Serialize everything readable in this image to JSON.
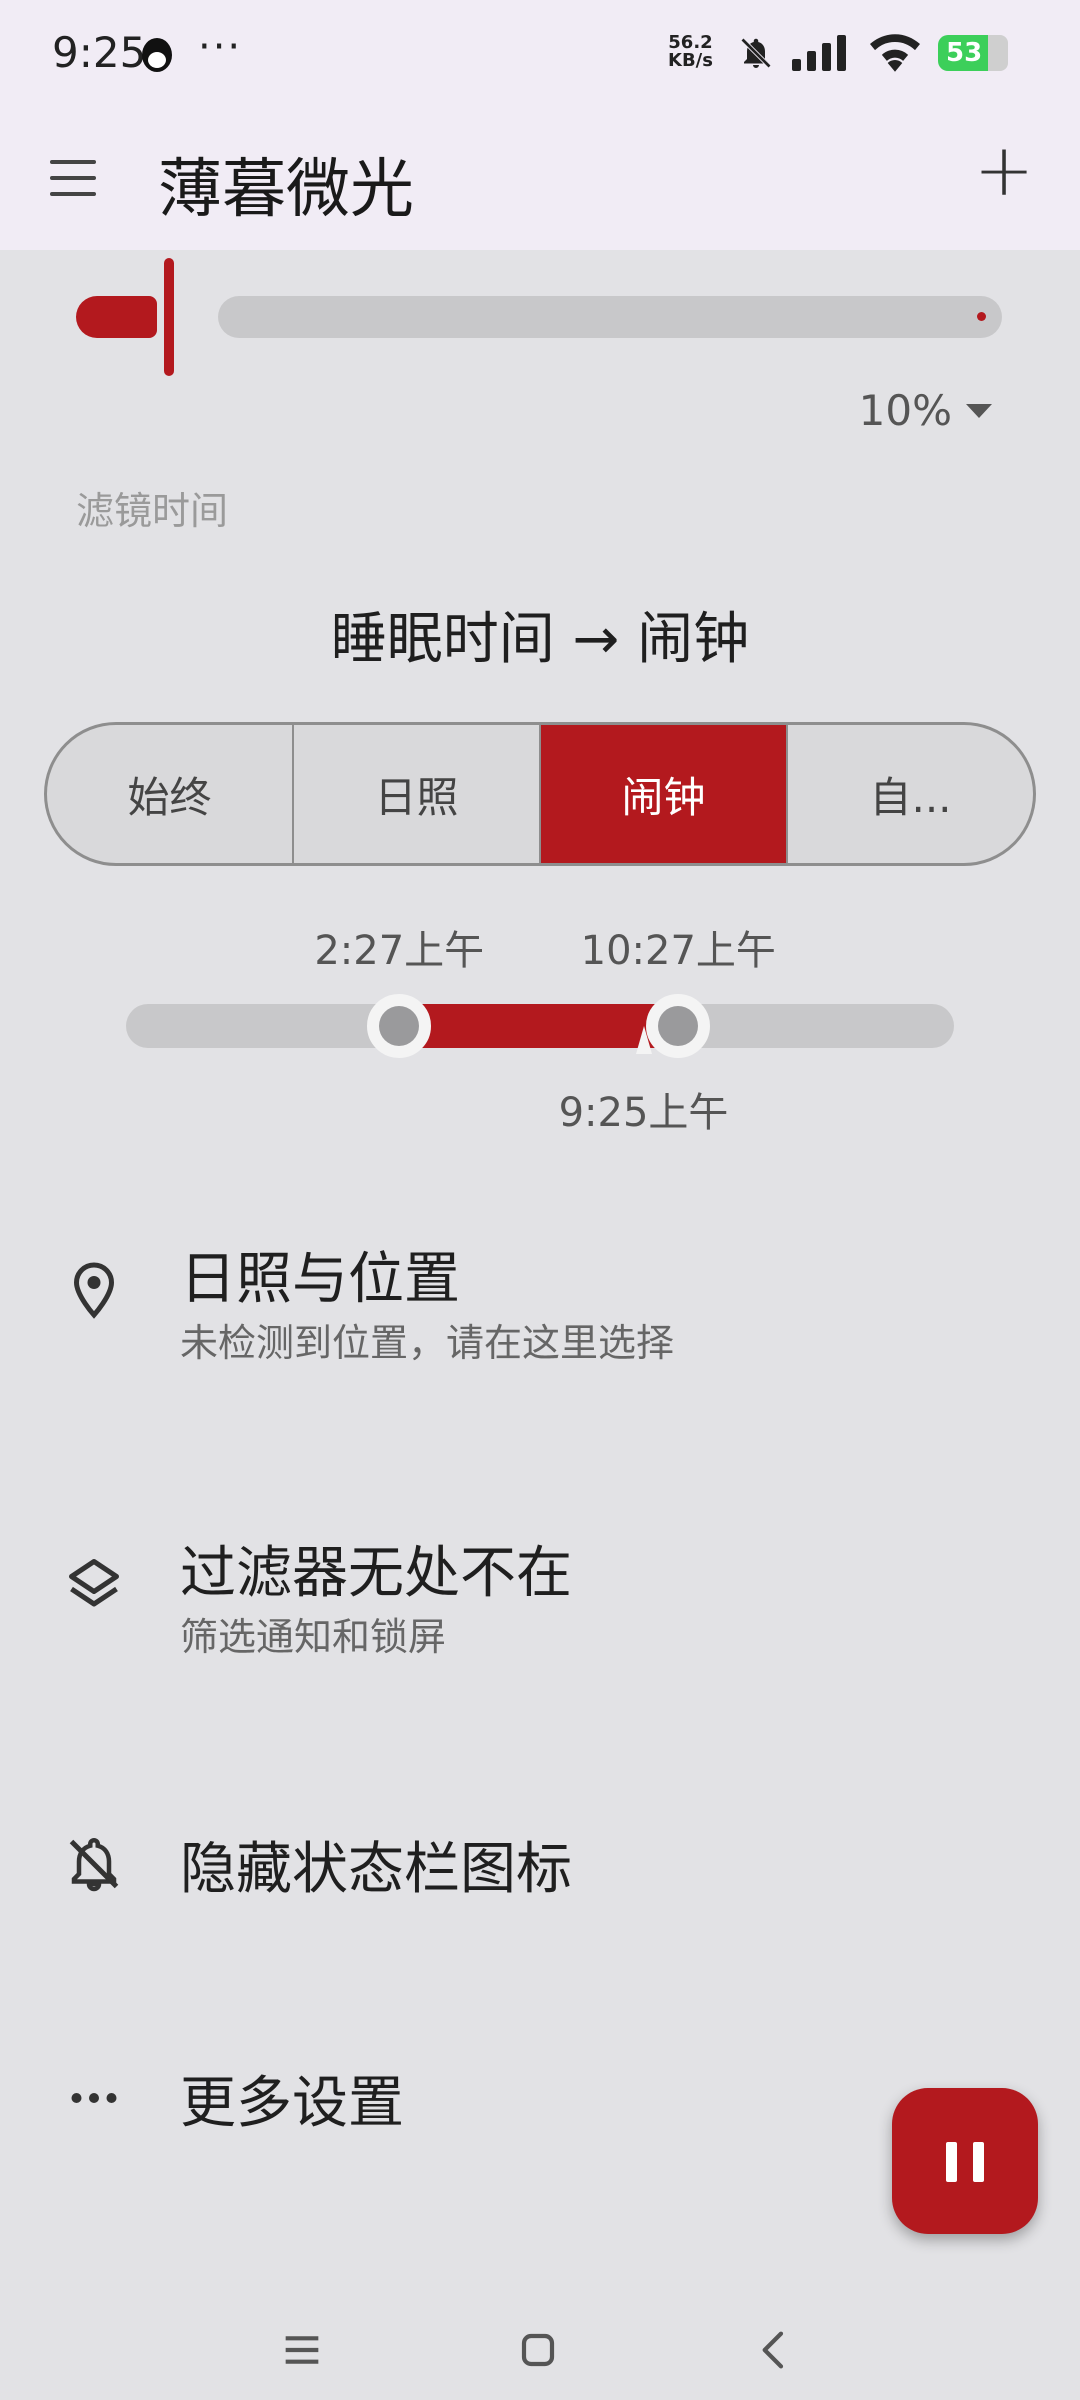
{
  "status_bar": {
    "time": "9:25",
    "more": "···",
    "net_speed_value": "56.2",
    "net_speed_unit": "KB/s",
    "battery": "53",
    "icons": [
      "qq-icon",
      "bell-off-icon",
      "signal-icon",
      "wifi-icon",
      "battery-charging-icon"
    ]
  },
  "app_bar": {
    "title": "薄暮微光",
    "menu_icon": "hamburger-menu-icon",
    "add_icon": "plus-icon"
  },
  "intensity": {
    "value_percent": 10,
    "label": "10%"
  },
  "schedule": {
    "section_label": "滤镜时间",
    "title": "睡眠时间 → 闹钟",
    "modes": [
      {
        "label": "始终",
        "active": false
      },
      {
        "label": "日照",
        "active": false
      },
      {
        "label": "闹钟",
        "active": true
      },
      {
        "label": "自...",
        "active": false
      }
    ],
    "start_label": "2:27上午",
    "end_label": "10:27上午",
    "now_label": "9:25上午",
    "range_start_fraction": 0.33,
    "range_end_fraction": 0.667,
    "now_fraction": 0.625
  },
  "settings": [
    {
      "title": "日照与位置",
      "subtitle": "未检测到位置，请在这里选择",
      "icon": "location-pin-icon"
    },
    {
      "title": "过滤器无处不在",
      "subtitle": "筛选通知和锁屏",
      "icon": "layers-icon"
    },
    {
      "title": "隐藏状态栏图标",
      "subtitle": "",
      "icon": "bell-off-icon"
    },
    {
      "title": "更多设置",
      "subtitle": "",
      "icon": "more-horiz-icon"
    }
  ],
  "fab": {
    "icon": "pause-icon"
  },
  "nav_bar": {
    "icons": [
      "recent-apps-icon",
      "home-icon",
      "back-icon"
    ]
  },
  "colors": {
    "accent": "#b3191e",
    "background": "#e2e2e5",
    "app_bar": "#f1ecf5"
  }
}
